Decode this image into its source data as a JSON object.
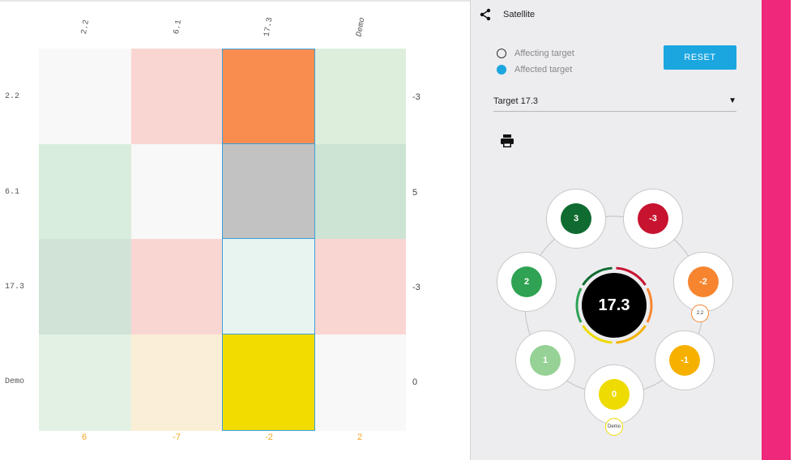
{
  "matrix": {
    "columns": [
      "2.2",
      "6.1",
      "17.3",
      "Demo"
    ],
    "rows": [
      "2.2",
      "6.1",
      "17.3",
      "Demo"
    ],
    "row_sums": [
      "-3",
      "5",
      "-3",
      "0"
    ],
    "col_sums": [
      "6",
      "-7",
      "-2",
      "2"
    ],
    "cell_colors": [
      [
        "#f8f8f8",
        "#fad6d3",
        "#f98d50",
        "#ddeedd"
      ],
      [
        "#d9eddc",
        "#f8f8f8",
        "#c2c2c2",
        "#cde3d4"
      ],
      [
        "#d0e3d6",
        "#fad6d3",
        "#e8f4f0",
        "#fad6d3"
      ],
      [
        "#e2f1e3",
        "#faefd6",
        "#f2dc00",
        "#f8f8f8"
      ]
    ],
    "selected_column": 2
  },
  "panel": {
    "title": "Satellite",
    "legend": {
      "affecting": "Affecting target",
      "affected": "Affected target"
    },
    "reset_label": "RESET",
    "target_label": "Target 17.3"
  },
  "satellite": {
    "center_label": "17.3",
    "nodes": [
      {
        "value": "3",
        "color": "#0f6b30"
      },
      {
        "value": "-3",
        "color": "#c7132f"
      },
      {
        "value": "-2",
        "color": "#f7852f",
        "tag": "2.2",
        "tag_color": "#f7852f"
      },
      {
        "value": "-1",
        "color": "#f6b100"
      },
      {
        "value": "0",
        "color": "#eedb00",
        "tag": "Demo",
        "tag_color": "#eedb00"
      },
      {
        "value": "1",
        "color": "#96d195"
      },
      {
        "value": "2",
        "color": "#2fa253"
      }
    ],
    "ring_colors": [
      "#c7132f",
      "#f7852f",
      "#f6b100",
      "#eedb00",
      "#2fa253",
      "#0f6b30"
    ]
  },
  "accent_colors": {
    "primary": "#1ba6e0",
    "side_bar": "#f0287b",
    "sum_orange": "#f5a623"
  }
}
